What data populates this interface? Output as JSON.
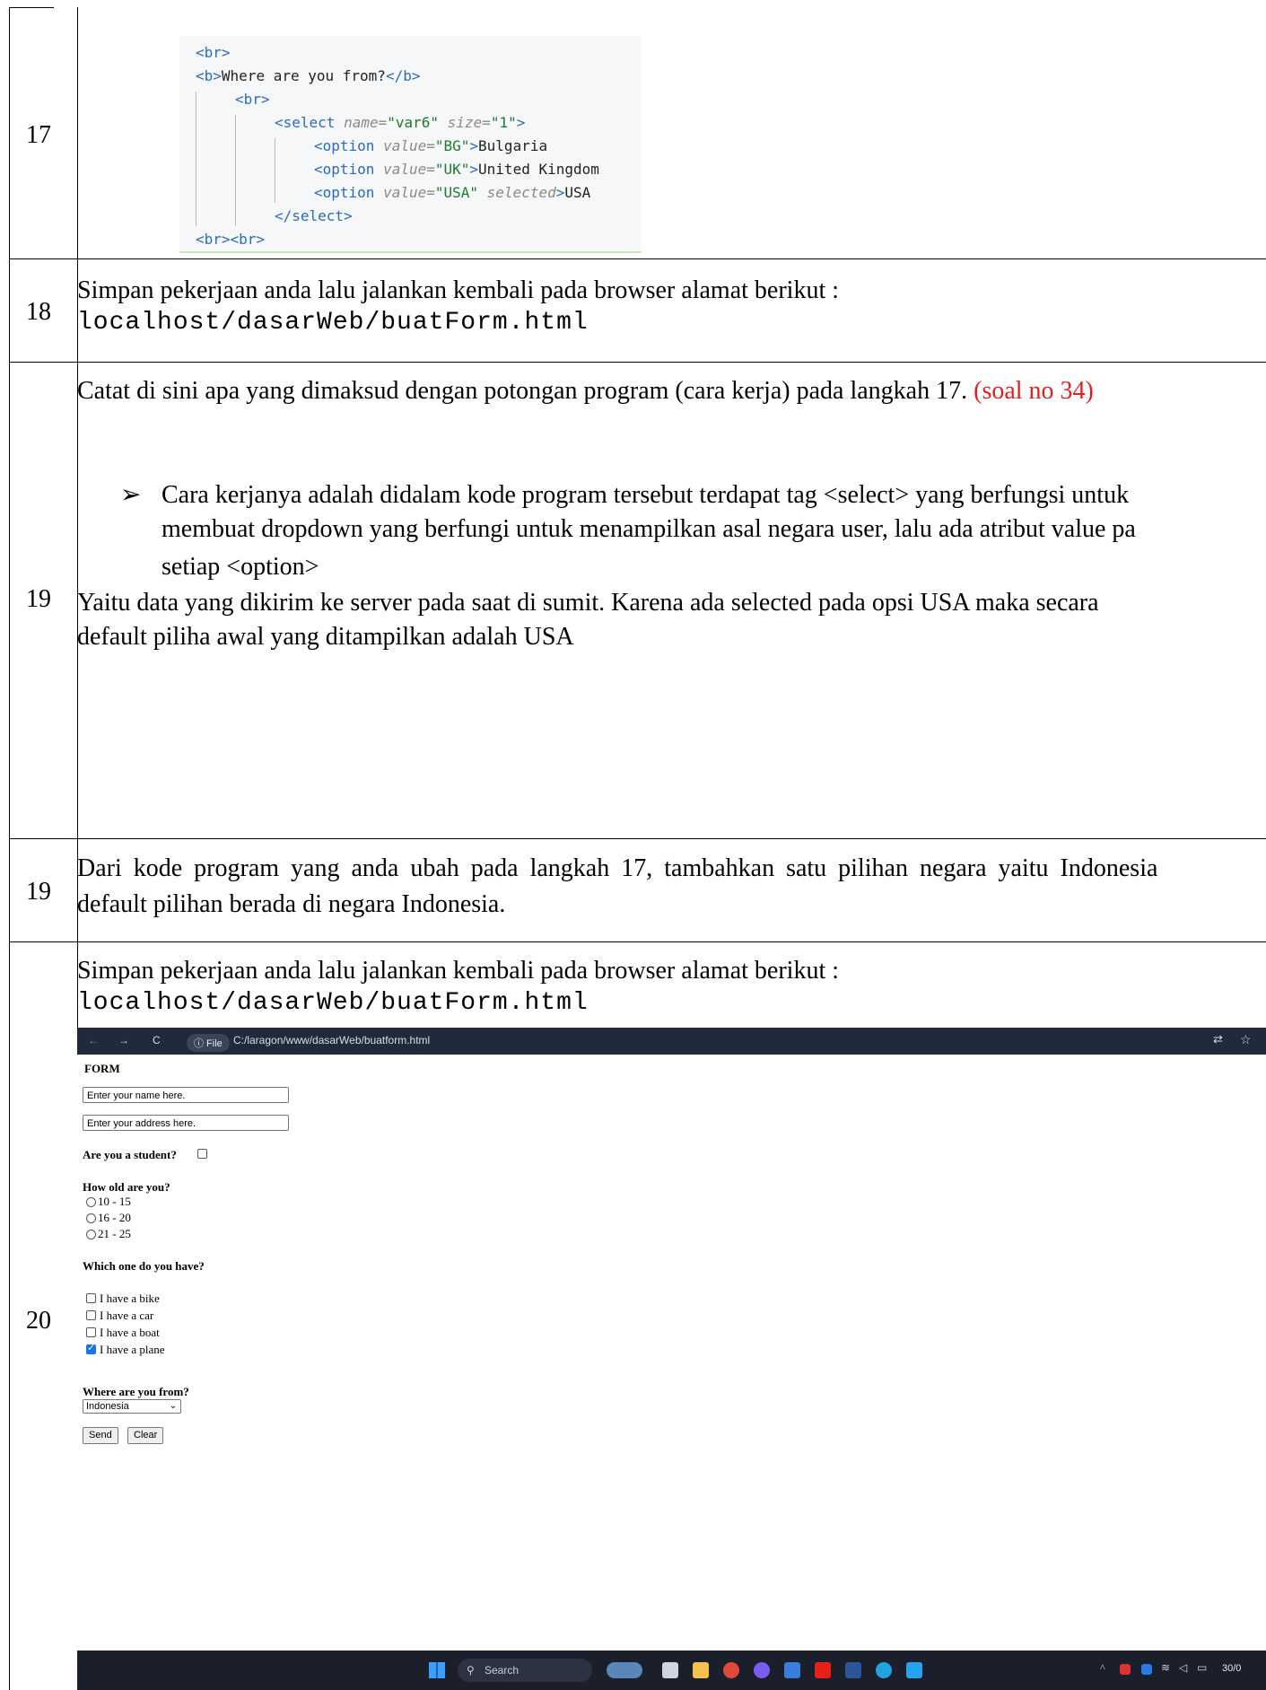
{
  "rows": [
    {
      "no": "17"
    },
    {
      "no": "18",
      "line1": "Simpan pekerjaan anda lalu jalankan kembali pada browser alamat berikut :",
      "line2": "localhost/dasarWeb/buatForm.html"
    },
    {
      "no": "19",
      "question": "Catat di sini apa yang dimaksud dengan potongan program (cara kerja) pada langkah 17.",
      "tag": "(soal no 34)",
      "bullet1": "Cara kerjanya adalah didalam kode program tersebut terdapat tag <select> yang berfungsi untuk",
      "bullet2": "membuat dropdown yang berfungi untuk menampilkan asal negara user, lalu ada atribut value pa",
      "bullet3": "setiap <option>",
      "para1": "Yaitu data yang dikirim ke server pada saat di sumit. Karena ada selected pada opsi USA maka secara",
      "para2": "default piliha  awal yang ditampilkan adalah USA"
    },
    {
      "no": "19",
      "line1": "Dari kode program yang anda ubah pada langkah 17, tambahkan satu pilihan negara yaitu Indonesia",
      "line2": "default pilihan berada di negara Indonesia."
    },
    {
      "no": "20",
      "line1": "Simpan pekerjaan anda lalu jalankan kembali pada browser alamat berikut :",
      "line2": "localhost/dasarWeb/buatForm.html"
    }
  ],
  "code": {
    "l1": "<br>",
    "l2a": "<b>",
    "l2b": "Where are you from?",
    "l2c": "</b>",
    "l3": "<br>",
    "l4a": "<select ",
    "l4b": "name=",
    "l4c": "\"var6\" ",
    "l4d": "size=",
    "l4e": "\"1\"",
    "l4f": ">",
    "o1a": "<option ",
    "o1b": "value=",
    "o1c": "\"BG\"",
    "o1d": ">",
    "o1e": "Bulgaria",
    "o2a": "<option ",
    "o2b": "value=",
    "o2c": "\"UK\"",
    "o2d": ">",
    "o2e": "United Kingdom",
    "o3a": "<option ",
    "o3b": "value=",
    "o3c": "\"USA\" ",
    "o3d": "selected",
    "o3e": ">",
    "o3f": "USA",
    "l8": "</select>",
    "l9": "<br><br>"
  },
  "browser": {
    "url": "C:/laragon/www/dasarWeb/buatform.html",
    "file_label": "ⓘ File",
    "form_title": "FORM",
    "name_placeholder": "Enter your name here.",
    "address_placeholder": "Enter your address here.",
    "student_q": "Are you a student?",
    "age_q": "How old are you?",
    "ages": [
      "10 - 15",
      "16 - 20",
      "21 - 25"
    ],
    "have_q": "Which one do you have?",
    "haves": [
      "I have a bike",
      "I have a car",
      "I have a boat",
      "I have a plane"
    ],
    "from_q": "Where are you from?",
    "country": "Indonesia",
    "send": "Send",
    "clear": "Clear",
    "search": "Search",
    "clock": "30/0"
  }
}
